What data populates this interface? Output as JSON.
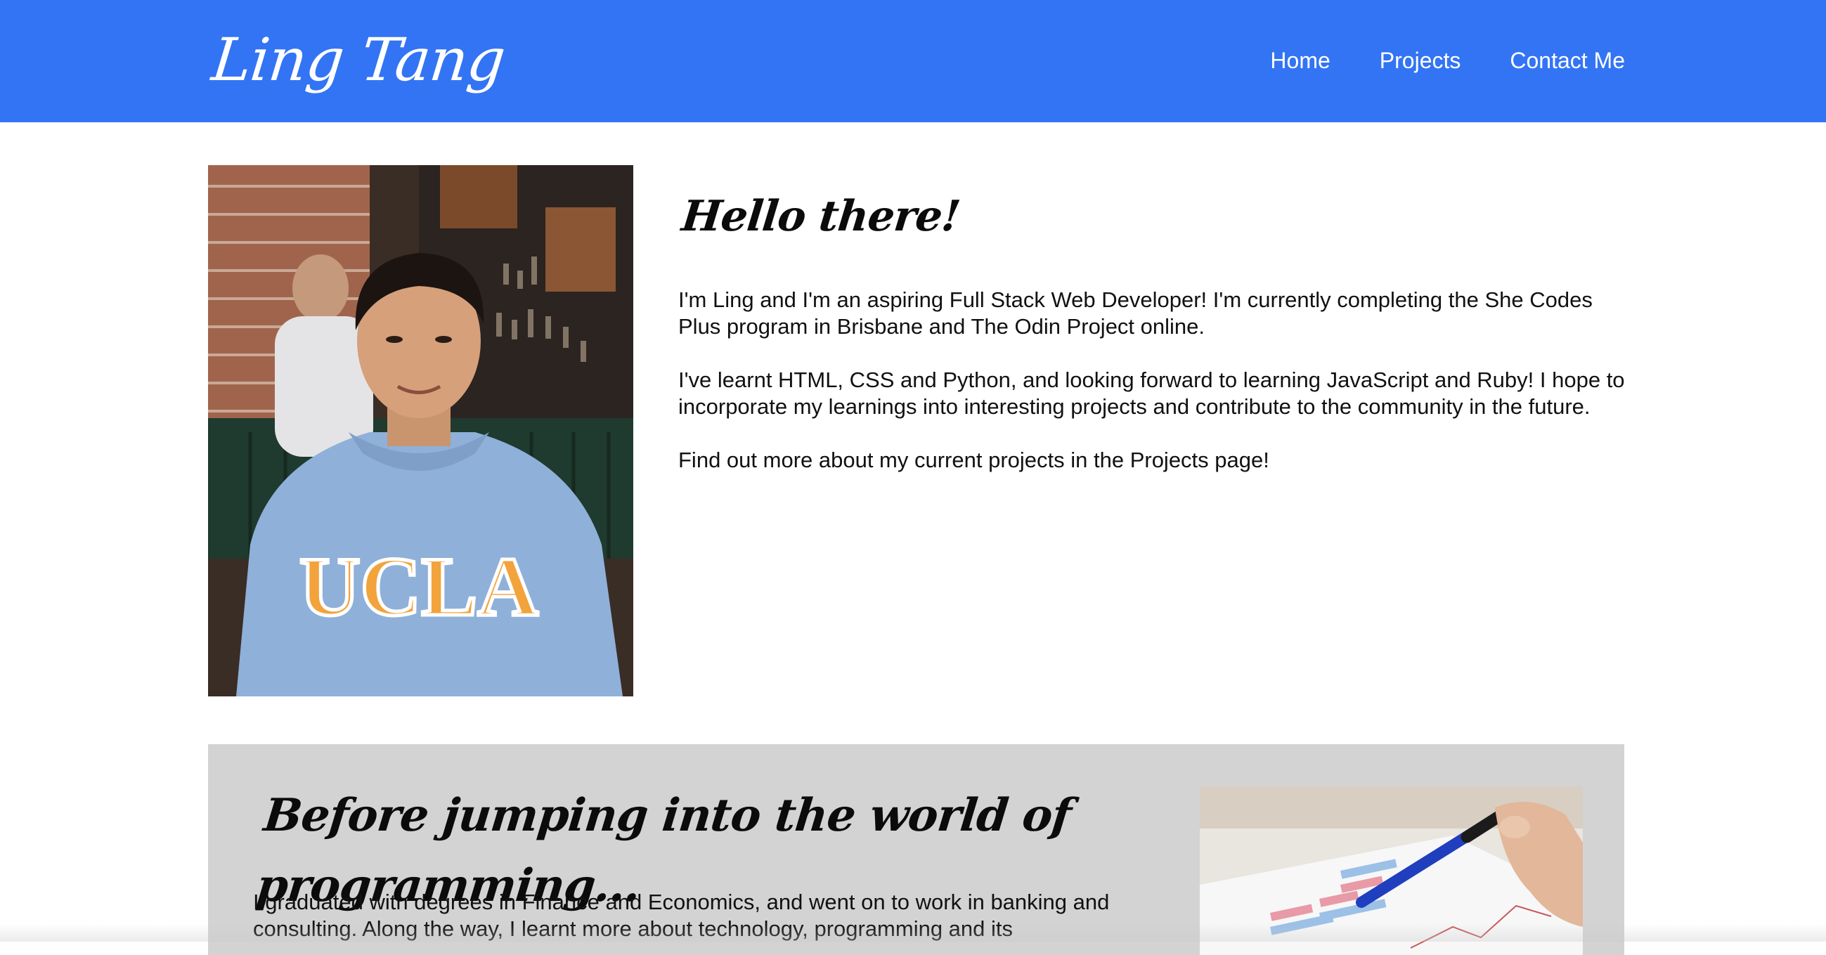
{
  "header": {
    "brand": "Ling Tang",
    "nav": [
      "Home",
      "Projects",
      "Contact Me"
    ]
  },
  "intro": {
    "heading": "Hello there!",
    "paragraphs": [
      "I'm Ling and I'm an aspiring Full Stack Web Developer! I'm currently completing the She Codes Plus program in Brisbane and The Odin Project online.",
      "I've learnt HTML, CSS and Python, and looking forward to learning JavaScript and Ruby! I hope to incorporate my learnings into interesting projects and contribute to the community in the future.",
      "Find out more about my current projects in the Projects page!"
    ],
    "photo_text": "UCLA"
  },
  "background": {
    "heading": "Before jumping into the world of programming...",
    "paragraph": "I graduated with degrees in Finance and Economics, and went on to work in banking and consulting. Along the way, I learnt more about technology, programming and its"
  },
  "colors": {
    "header_bg": "#3374f4",
    "section_bg": "#d3d3d3",
    "text": "#111111",
    "nav_text": "#ffffff"
  }
}
